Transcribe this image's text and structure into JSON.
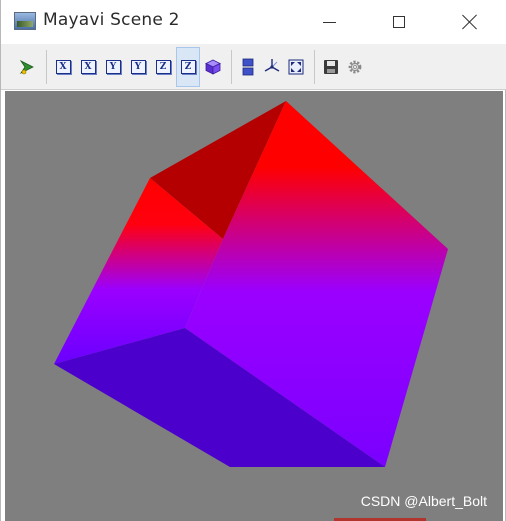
{
  "window": {
    "title": "Mayavi Scene 2",
    "app_icon": "mayavi-scene-icon",
    "controls": [
      "minimize-icon",
      "maximize-icon",
      "close-icon"
    ]
  },
  "toolbar": {
    "buttons": [
      {
        "name": "mayavi-pipeline-button",
        "icon": "mayavi-pipeline-icon"
      },
      {
        "name": "view-x-plus-button",
        "icon": "axis-x-icon",
        "label": "X"
      },
      {
        "name": "view-x-minus-button",
        "icon": "axis-x-icon",
        "label": "X"
      },
      {
        "name": "view-y-plus-button",
        "icon": "axis-y-icon",
        "label": "Y"
      },
      {
        "name": "view-y-minus-button",
        "icon": "axis-y-icon",
        "label": "Y"
      },
      {
        "name": "view-z-plus-button",
        "icon": "axis-z-icon",
        "label": "Z"
      },
      {
        "name": "view-z-minus-button",
        "icon": "axis-z-icon",
        "label": "Z",
        "active": true
      },
      {
        "name": "isometric-view-button",
        "icon": "isometric-cube-icon"
      },
      {
        "name": "parallel-projection-button",
        "icon": "projection-toggle-icon"
      },
      {
        "name": "toggle-axes-button",
        "icon": "axes-indicator-icon"
      },
      {
        "name": "full-screen-button",
        "icon": "full-screen-icon"
      },
      {
        "name": "save-scene-button",
        "icon": "save-icon"
      },
      {
        "name": "configure-scene-button",
        "icon": "gear-icon"
      }
    ]
  },
  "scene": {
    "background_color": "#7f7f7f",
    "object": "cube",
    "gradient_colors": [
      "#ff0000",
      "#7a00ff"
    ],
    "face_colors": {
      "top_shadow": "#b00000",
      "bottom": "#4a00c8"
    }
  },
  "watermark": {
    "text": "CSDN @Albert_Bolt"
  }
}
